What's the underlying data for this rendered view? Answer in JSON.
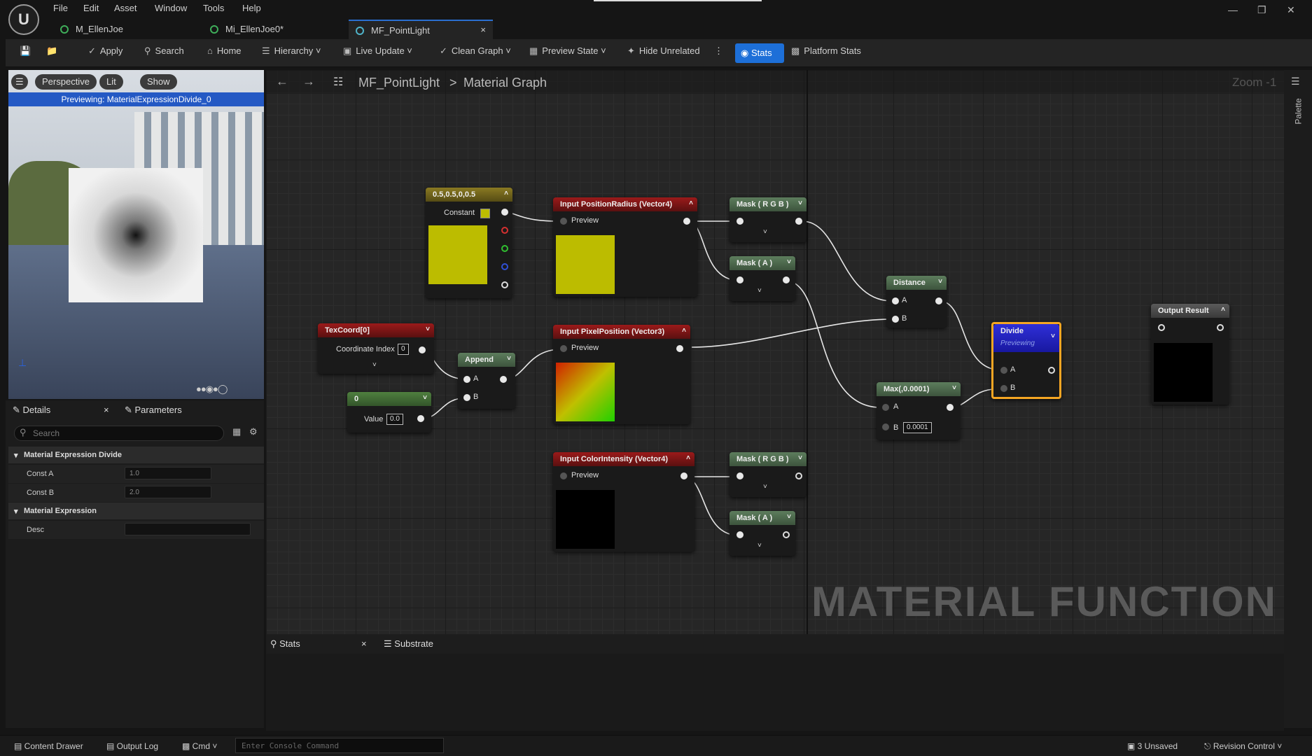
{
  "menu": [
    "File",
    "Edit",
    "Asset",
    "Window",
    "Tools",
    "Help"
  ],
  "tabs": [
    {
      "label": "M_EllenJoe"
    },
    {
      "label": "Mi_EllenJoe0*"
    },
    {
      "label": "MF_PointLight",
      "close": "×"
    }
  ],
  "toolbar": {
    "apply": "Apply",
    "search": "Search",
    "home": "Home",
    "hierarchy": "Hierarchy",
    "live_update": "Live Update",
    "clean_graph": "Clean Graph",
    "preview_state": "Preview State",
    "hide_unrelated": "Hide Unrelated",
    "stats": "Stats",
    "platform_stats": "Platform Stats"
  },
  "viewport": {
    "perspective": "Perspective",
    "lit": "Lit",
    "show": "Show",
    "previewing": "Previewing: MaterialExpressionDivide_0"
  },
  "details": {
    "tab_details": "Details",
    "tab_parameters": "Parameters",
    "close": "×",
    "search_placeholder": "Search",
    "section1": "Material Expression Divide",
    "const_a_label": "Const A",
    "const_a": "1.0",
    "const_b_label": "Const B",
    "const_b": "2.0",
    "section2": "Material Expression",
    "desc_label": "Desc",
    "desc": ""
  },
  "graph": {
    "breadcrumb_root": "MF_PointLight",
    "breadcrumb_sep": ">",
    "breadcrumb_leaf": "Material Graph",
    "zoom": "Zoom -1",
    "watermark": "MATERIAL FUNCTION",
    "nodes": {
      "const4": {
        "title": "0.5,0.5,0,0.5",
        "label": "Constant"
      },
      "input_posrad": {
        "title": "Input PositionRadius (Vector4)",
        "preview": "Preview"
      },
      "mask_rgb1": {
        "title": "Mask ( R G B )"
      },
      "mask_a1": {
        "title": "Mask ( A )"
      },
      "distance": {
        "title": "Distance",
        "a": "A",
        "b": "B"
      },
      "texcoord": {
        "title": "TexCoord[0]",
        "label": "Coordinate Index",
        "value": "0"
      },
      "append": {
        "title": "Append",
        "a": "A",
        "b": "B"
      },
      "const0": {
        "title": "0",
        "label": "Value",
        "value": "0.0"
      },
      "input_pixpos": {
        "title": "Input PixelPosition (Vector3)",
        "preview": "Preview"
      },
      "divide": {
        "title": "Divide",
        "sub": "Previewing",
        "a": "A",
        "b": "B"
      },
      "max": {
        "title": "Max(,0.0001)",
        "a": "A",
        "b": "B",
        "b_value": "0.0001"
      },
      "output": {
        "title": "Output Result"
      },
      "input_color": {
        "title": "Input ColorIntensity (Vector4)",
        "preview": "Preview"
      },
      "mask_rgb2": {
        "title": "Mask ( R G B )"
      },
      "mask_a2": {
        "title": "Mask ( A )"
      }
    }
  },
  "bottom": {
    "stats_tab": "Stats",
    "substrate_tab": "Substrate",
    "close": "×"
  },
  "status": {
    "content_drawer": "Content Drawer",
    "output_log": "Output Log",
    "cmd": "Cmd",
    "console_placeholder": "Enter Console Command",
    "unsaved": "3 Unsaved",
    "revision": "Revision Control"
  },
  "palette": {
    "label": "Palette"
  },
  "colors": {
    "accent": "#1d6fd8",
    "node_selected": "#f5a623",
    "constant_color": "#bcbc00"
  }
}
